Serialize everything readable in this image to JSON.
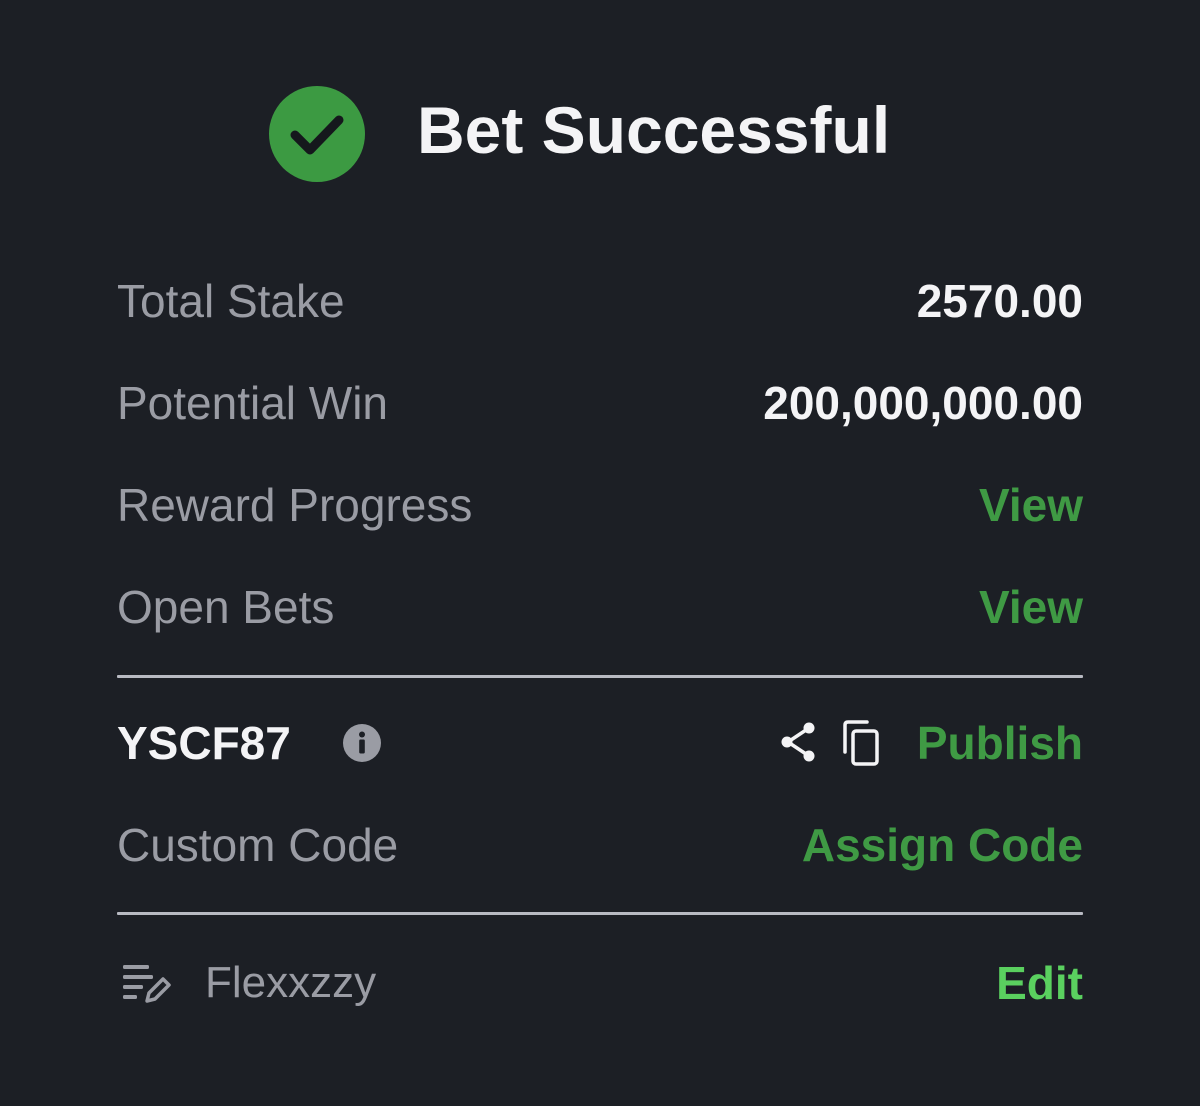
{
  "header": {
    "title": "Bet Successful",
    "status_icon": "check-circle-icon",
    "status_color": "#3c9a42"
  },
  "summary": {
    "total_stake_label": "Total Stake",
    "total_stake_value": "2570.00",
    "potential_win_label": "Potential Win",
    "potential_win_value": "200,000,000.00",
    "reward_progress_label": "Reward Progress",
    "reward_progress_link": "View",
    "open_bets_label": "Open Bets",
    "open_bets_link": "View"
  },
  "booking": {
    "code": "YSCF87",
    "info_icon": "info-icon",
    "share_icon": "share-icon",
    "copy_icon": "copy-icon",
    "publish_label": "Publish",
    "custom_code_label": "Custom Code",
    "assign_code_label": "Assign Code"
  },
  "note": {
    "icon": "note-edit-icon",
    "text": "Flexxzzy",
    "edit_label": "Edit"
  },
  "colors": {
    "background": "#1c1f25",
    "accent_green": "#3f9a44",
    "edit_green": "#5ad05f",
    "label_gray": "#9a9ca4",
    "value_white": "#f4f4f6"
  }
}
